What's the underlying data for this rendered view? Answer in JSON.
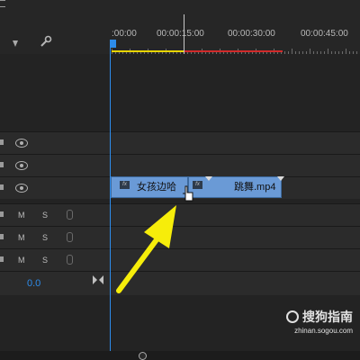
{
  "ruler": {
    "timecodes": [
      ":00:00",
      "00:00:15:00",
      "00:00:30:00",
      "00:00:45:00"
    ]
  },
  "tracks": {
    "audio_buttons": [
      {
        "m": "M",
        "s": "S"
      },
      {
        "m": "M",
        "s": "S"
      },
      {
        "m": "M",
        "s": "S"
      }
    ],
    "master_volume": "0.0"
  },
  "clips": [
    {
      "label": "女孩边哈"
    },
    {
      "label": "跳舞.mp4"
    }
  ],
  "fx_badge": "fx",
  "watermark": {
    "main": "搜狗指南",
    "url": "zhinan.sogou.com"
  },
  "colors": {
    "playhead": "#2d8ceb",
    "clip": "#6a9ad6",
    "arrow": "#f6ed0a",
    "work_area_yellow": "#e8d500",
    "work_area_red": "#d12b2b"
  }
}
